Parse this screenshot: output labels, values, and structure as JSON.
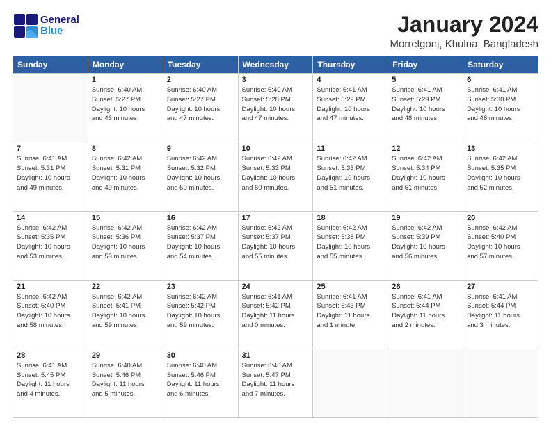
{
  "header": {
    "logo_general": "General",
    "logo_blue": "Blue",
    "month_title": "January 2024",
    "location": "Morrelgonj, Khulna, Bangladesh"
  },
  "weekdays": [
    "Sunday",
    "Monday",
    "Tuesday",
    "Wednesday",
    "Thursday",
    "Friday",
    "Saturday"
  ],
  "weeks": [
    [
      {
        "day": "",
        "sunrise": "",
        "sunset": "",
        "daylight": ""
      },
      {
        "day": "1",
        "sunrise": "Sunrise: 6:40 AM",
        "sunset": "Sunset: 5:27 PM",
        "daylight": "Daylight: 10 hours and 46 minutes."
      },
      {
        "day": "2",
        "sunrise": "Sunrise: 6:40 AM",
        "sunset": "Sunset: 5:27 PM",
        "daylight": "Daylight: 10 hours and 47 minutes."
      },
      {
        "day": "3",
        "sunrise": "Sunrise: 6:40 AM",
        "sunset": "Sunset: 5:28 PM",
        "daylight": "Daylight: 10 hours and 47 minutes."
      },
      {
        "day": "4",
        "sunrise": "Sunrise: 6:41 AM",
        "sunset": "Sunset: 5:29 PM",
        "daylight": "Daylight: 10 hours and 47 minutes."
      },
      {
        "day": "5",
        "sunrise": "Sunrise: 6:41 AM",
        "sunset": "Sunset: 5:29 PM",
        "daylight": "Daylight: 10 hours and 48 minutes."
      },
      {
        "day": "6",
        "sunrise": "Sunrise: 6:41 AM",
        "sunset": "Sunset: 5:30 PM",
        "daylight": "Daylight: 10 hours and 48 minutes."
      }
    ],
    [
      {
        "day": "7",
        "sunrise": "Sunrise: 6:41 AM",
        "sunset": "Sunset: 5:31 PM",
        "daylight": "Daylight: 10 hours and 49 minutes."
      },
      {
        "day": "8",
        "sunrise": "Sunrise: 6:42 AM",
        "sunset": "Sunset: 5:31 PM",
        "daylight": "Daylight: 10 hours and 49 minutes."
      },
      {
        "day": "9",
        "sunrise": "Sunrise: 6:42 AM",
        "sunset": "Sunset: 5:32 PM",
        "daylight": "Daylight: 10 hours and 50 minutes."
      },
      {
        "day": "10",
        "sunrise": "Sunrise: 6:42 AM",
        "sunset": "Sunset: 5:33 PM",
        "daylight": "Daylight: 10 hours and 50 minutes."
      },
      {
        "day": "11",
        "sunrise": "Sunrise: 6:42 AM",
        "sunset": "Sunset: 5:33 PM",
        "daylight": "Daylight: 10 hours and 51 minutes."
      },
      {
        "day": "12",
        "sunrise": "Sunrise: 6:42 AM",
        "sunset": "Sunset: 5:34 PM",
        "daylight": "Daylight: 10 hours and 51 minutes."
      },
      {
        "day": "13",
        "sunrise": "Sunrise: 6:42 AM",
        "sunset": "Sunset: 5:35 PM",
        "daylight": "Daylight: 10 hours and 52 minutes."
      }
    ],
    [
      {
        "day": "14",
        "sunrise": "Sunrise: 6:42 AM",
        "sunset": "Sunset: 5:35 PM",
        "daylight": "Daylight: 10 hours and 53 minutes."
      },
      {
        "day": "15",
        "sunrise": "Sunrise: 6:42 AM",
        "sunset": "Sunset: 5:36 PM",
        "daylight": "Daylight: 10 hours and 53 minutes."
      },
      {
        "day": "16",
        "sunrise": "Sunrise: 6:42 AM",
        "sunset": "Sunset: 5:37 PM",
        "daylight": "Daylight: 10 hours and 54 minutes."
      },
      {
        "day": "17",
        "sunrise": "Sunrise: 6:42 AM",
        "sunset": "Sunset: 5:37 PM",
        "daylight": "Daylight: 10 hours and 55 minutes."
      },
      {
        "day": "18",
        "sunrise": "Sunrise: 6:42 AM",
        "sunset": "Sunset: 5:38 PM",
        "daylight": "Daylight: 10 hours and 55 minutes."
      },
      {
        "day": "19",
        "sunrise": "Sunrise: 6:42 AM",
        "sunset": "Sunset: 5:39 PM",
        "daylight": "Daylight: 10 hours and 56 minutes."
      },
      {
        "day": "20",
        "sunrise": "Sunrise: 6:42 AM",
        "sunset": "Sunset: 5:40 PM",
        "daylight": "Daylight: 10 hours and 57 minutes."
      }
    ],
    [
      {
        "day": "21",
        "sunrise": "Sunrise: 6:42 AM",
        "sunset": "Sunset: 5:40 PM",
        "daylight": "Daylight: 10 hours and 58 minutes."
      },
      {
        "day": "22",
        "sunrise": "Sunrise: 6:42 AM",
        "sunset": "Sunset: 5:41 PM",
        "daylight": "Daylight: 10 hours and 59 minutes."
      },
      {
        "day": "23",
        "sunrise": "Sunrise: 6:42 AM",
        "sunset": "Sunset: 5:42 PM",
        "daylight": "Daylight: 10 hours and 59 minutes."
      },
      {
        "day": "24",
        "sunrise": "Sunrise: 6:41 AM",
        "sunset": "Sunset: 5:42 PM",
        "daylight": "Daylight: 11 hours and 0 minutes."
      },
      {
        "day": "25",
        "sunrise": "Sunrise: 6:41 AM",
        "sunset": "Sunset: 5:43 PM",
        "daylight": "Daylight: 11 hours and 1 minute."
      },
      {
        "day": "26",
        "sunrise": "Sunrise: 6:41 AM",
        "sunset": "Sunset: 5:44 PM",
        "daylight": "Daylight: 11 hours and 2 minutes."
      },
      {
        "day": "27",
        "sunrise": "Sunrise: 6:41 AM",
        "sunset": "Sunset: 5:44 PM",
        "daylight": "Daylight: 11 hours and 3 minutes."
      }
    ],
    [
      {
        "day": "28",
        "sunrise": "Sunrise: 6:41 AM",
        "sunset": "Sunset: 5:45 PM",
        "daylight": "Daylight: 11 hours and 4 minutes."
      },
      {
        "day": "29",
        "sunrise": "Sunrise: 6:40 AM",
        "sunset": "Sunset: 5:46 PM",
        "daylight": "Daylight: 11 hours and 5 minutes."
      },
      {
        "day": "30",
        "sunrise": "Sunrise: 6:40 AM",
        "sunset": "Sunset: 5:46 PM",
        "daylight": "Daylight: 11 hours and 6 minutes."
      },
      {
        "day": "31",
        "sunrise": "Sunrise: 6:40 AM",
        "sunset": "Sunset: 5:47 PM",
        "daylight": "Daylight: 11 hours and 7 minutes."
      },
      {
        "day": "",
        "sunrise": "",
        "sunset": "",
        "daylight": ""
      },
      {
        "day": "",
        "sunrise": "",
        "sunset": "",
        "daylight": ""
      },
      {
        "day": "",
        "sunrise": "",
        "sunset": "",
        "daylight": ""
      }
    ]
  ]
}
